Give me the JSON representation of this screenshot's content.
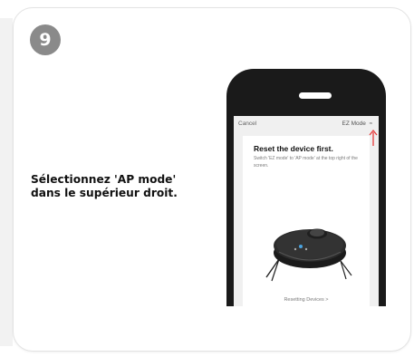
{
  "step": {
    "number": "9"
  },
  "instruction": {
    "line1": "Sélectionnez 'AP mode'",
    "line2": "dans le supérieur droit."
  },
  "app": {
    "cancel_label": "Cancel",
    "mode_label": "EZ Mode",
    "mode_icon": "wifi-icon",
    "title": "Reset the device first.",
    "subtitle": "Switch 'EZ mode' to 'AP mode' at the top right of the screen.",
    "link_label": "Resetting Devices >",
    "arrow_color": "#e63b3b"
  }
}
